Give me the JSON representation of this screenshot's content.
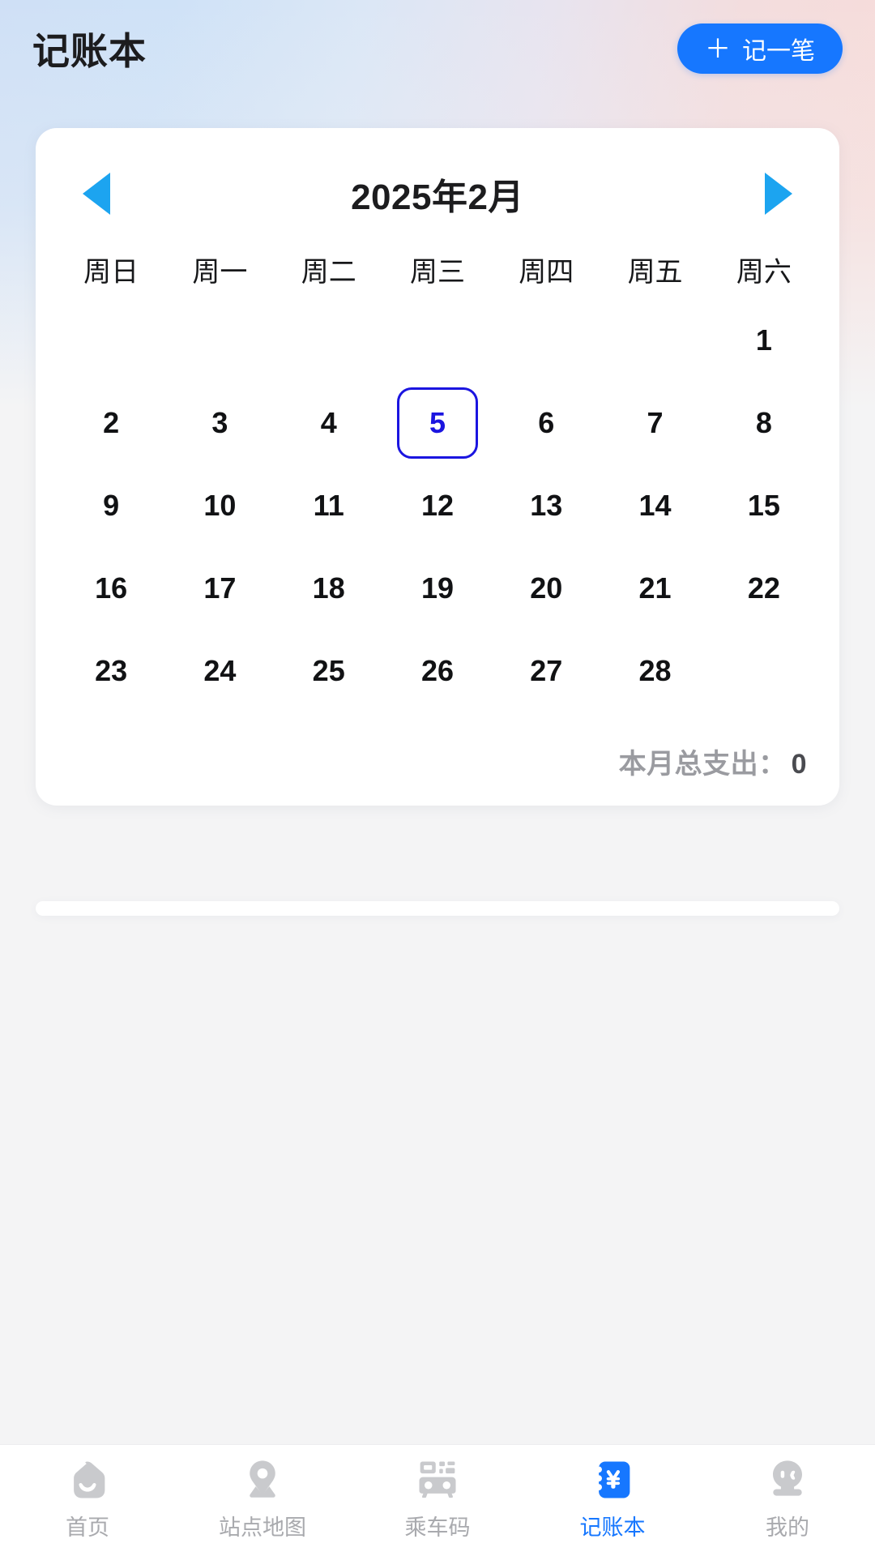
{
  "header": {
    "title": "记账本",
    "add_button": {
      "icon": "plus-icon",
      "plus": "＋",
      "label": "记一笔"
    }
  },
  "calendar": {
    "prev_icon": "triangle-left-icon",
    "next_icon": "triangle-right-icon",
    "month_label": "2025年2月",
    "weekdays": [
      "周日",
      "周一",
      "周二",
      "周三",
      "周四",
      "周五",
      "周六"
    ],
    "leading_blanks": 6,
    "days": [
      1,
      2,
      3,
      4,
      5,
      6,
      7,
      8,
      9,
      10,
      11,
      12,
      13,
      14,
      15,
      16,
      17,
      18,
      19,
      20,
      21,
      22,
      23,
      24,
      25,
      26,
      27,
      28
    ],
    "selected_day": 5,
    "total": {
      "label": "本月总支出：",
      "amount": "0"
    },
    "colors": {
      "selected_border": "#1b15e0",
      "selected_text": "#1b15e0",
      "arrow": "#1ca4f0",
      "accent": "#1677ff"
    }
  },
  "bottom_nav": {
    "items": [
      {
        "icon": "home-icon",
        "label": "首页",
        "active": false
      },
      {
        "icon": "map-pin-icon",
        "label": "站点地图",
        "active": false
      },
      {
        "icon": "bus-qr-icon",
        "label": "乘车码",
        "active": false
      },
      {
        "icon": "yuan-ticket-icon",
        "label": "记账本",
        "active": true
      },
      {
        "icon": "profile-icon",
        "label": "我的",
        "active": false
      }
    ]
  }
}
